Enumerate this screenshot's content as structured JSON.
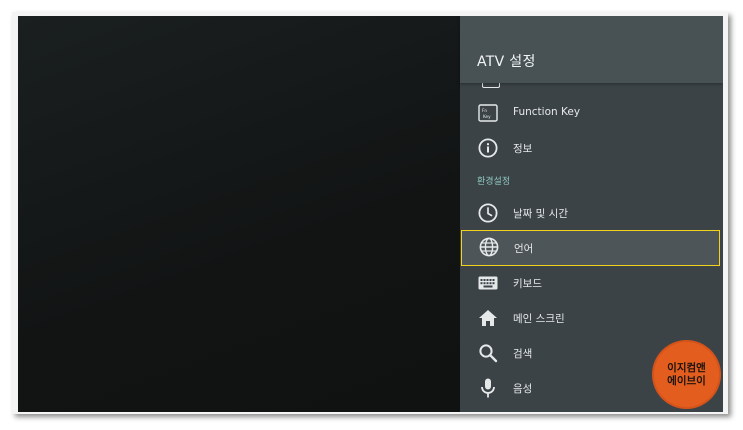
{
  "panel": {
    "title": "ATV 설정",
    "items_top": [
      {
        "id": "function-key",
        "icon": "function-key-icon",
        "key_caption": "Fn Key",
        "label": "Function Key"
      },
      {
        "id": "info",
        "icon": "info-icon",
        "label": "정보"
      }
    ],
    "section_header": "환경설정",
    "items": [
      {
        "id": "date-time",
        "icon": "clock-icon",
        "label": "날짜 및 시간"
      },
      {
        "id": "language",
        "icon": "globe-icon",
        "label": "언어",
        "selected": true
      },
      {
        "id": "keyboard",
        "icon": "keyboard-icon",
        "label": "키보드"
      },
      {
        "id": "home-screen",
        "icon": "home-icon",
        "label": "메인 스크린"
      },
      {
        "id": "search",
        "icon": "search-icon",
        "label": "검색"
      },
      {
        "id": "voice",
        "icon": "microphone-icon",
        "label": "음성"
      }
    ]
  },
  "watermark": {
    "line1": "이지컴앤",
    "line2": "에이브이",
    "color": "#e35d1e"
  },
  "colors": {
    "panel_bg": "#3b4347",
    "header_bg": "#485154",
    "accent_section": "#8fc7bd",
    "selection_border": "#f2d21b"
  }
}
